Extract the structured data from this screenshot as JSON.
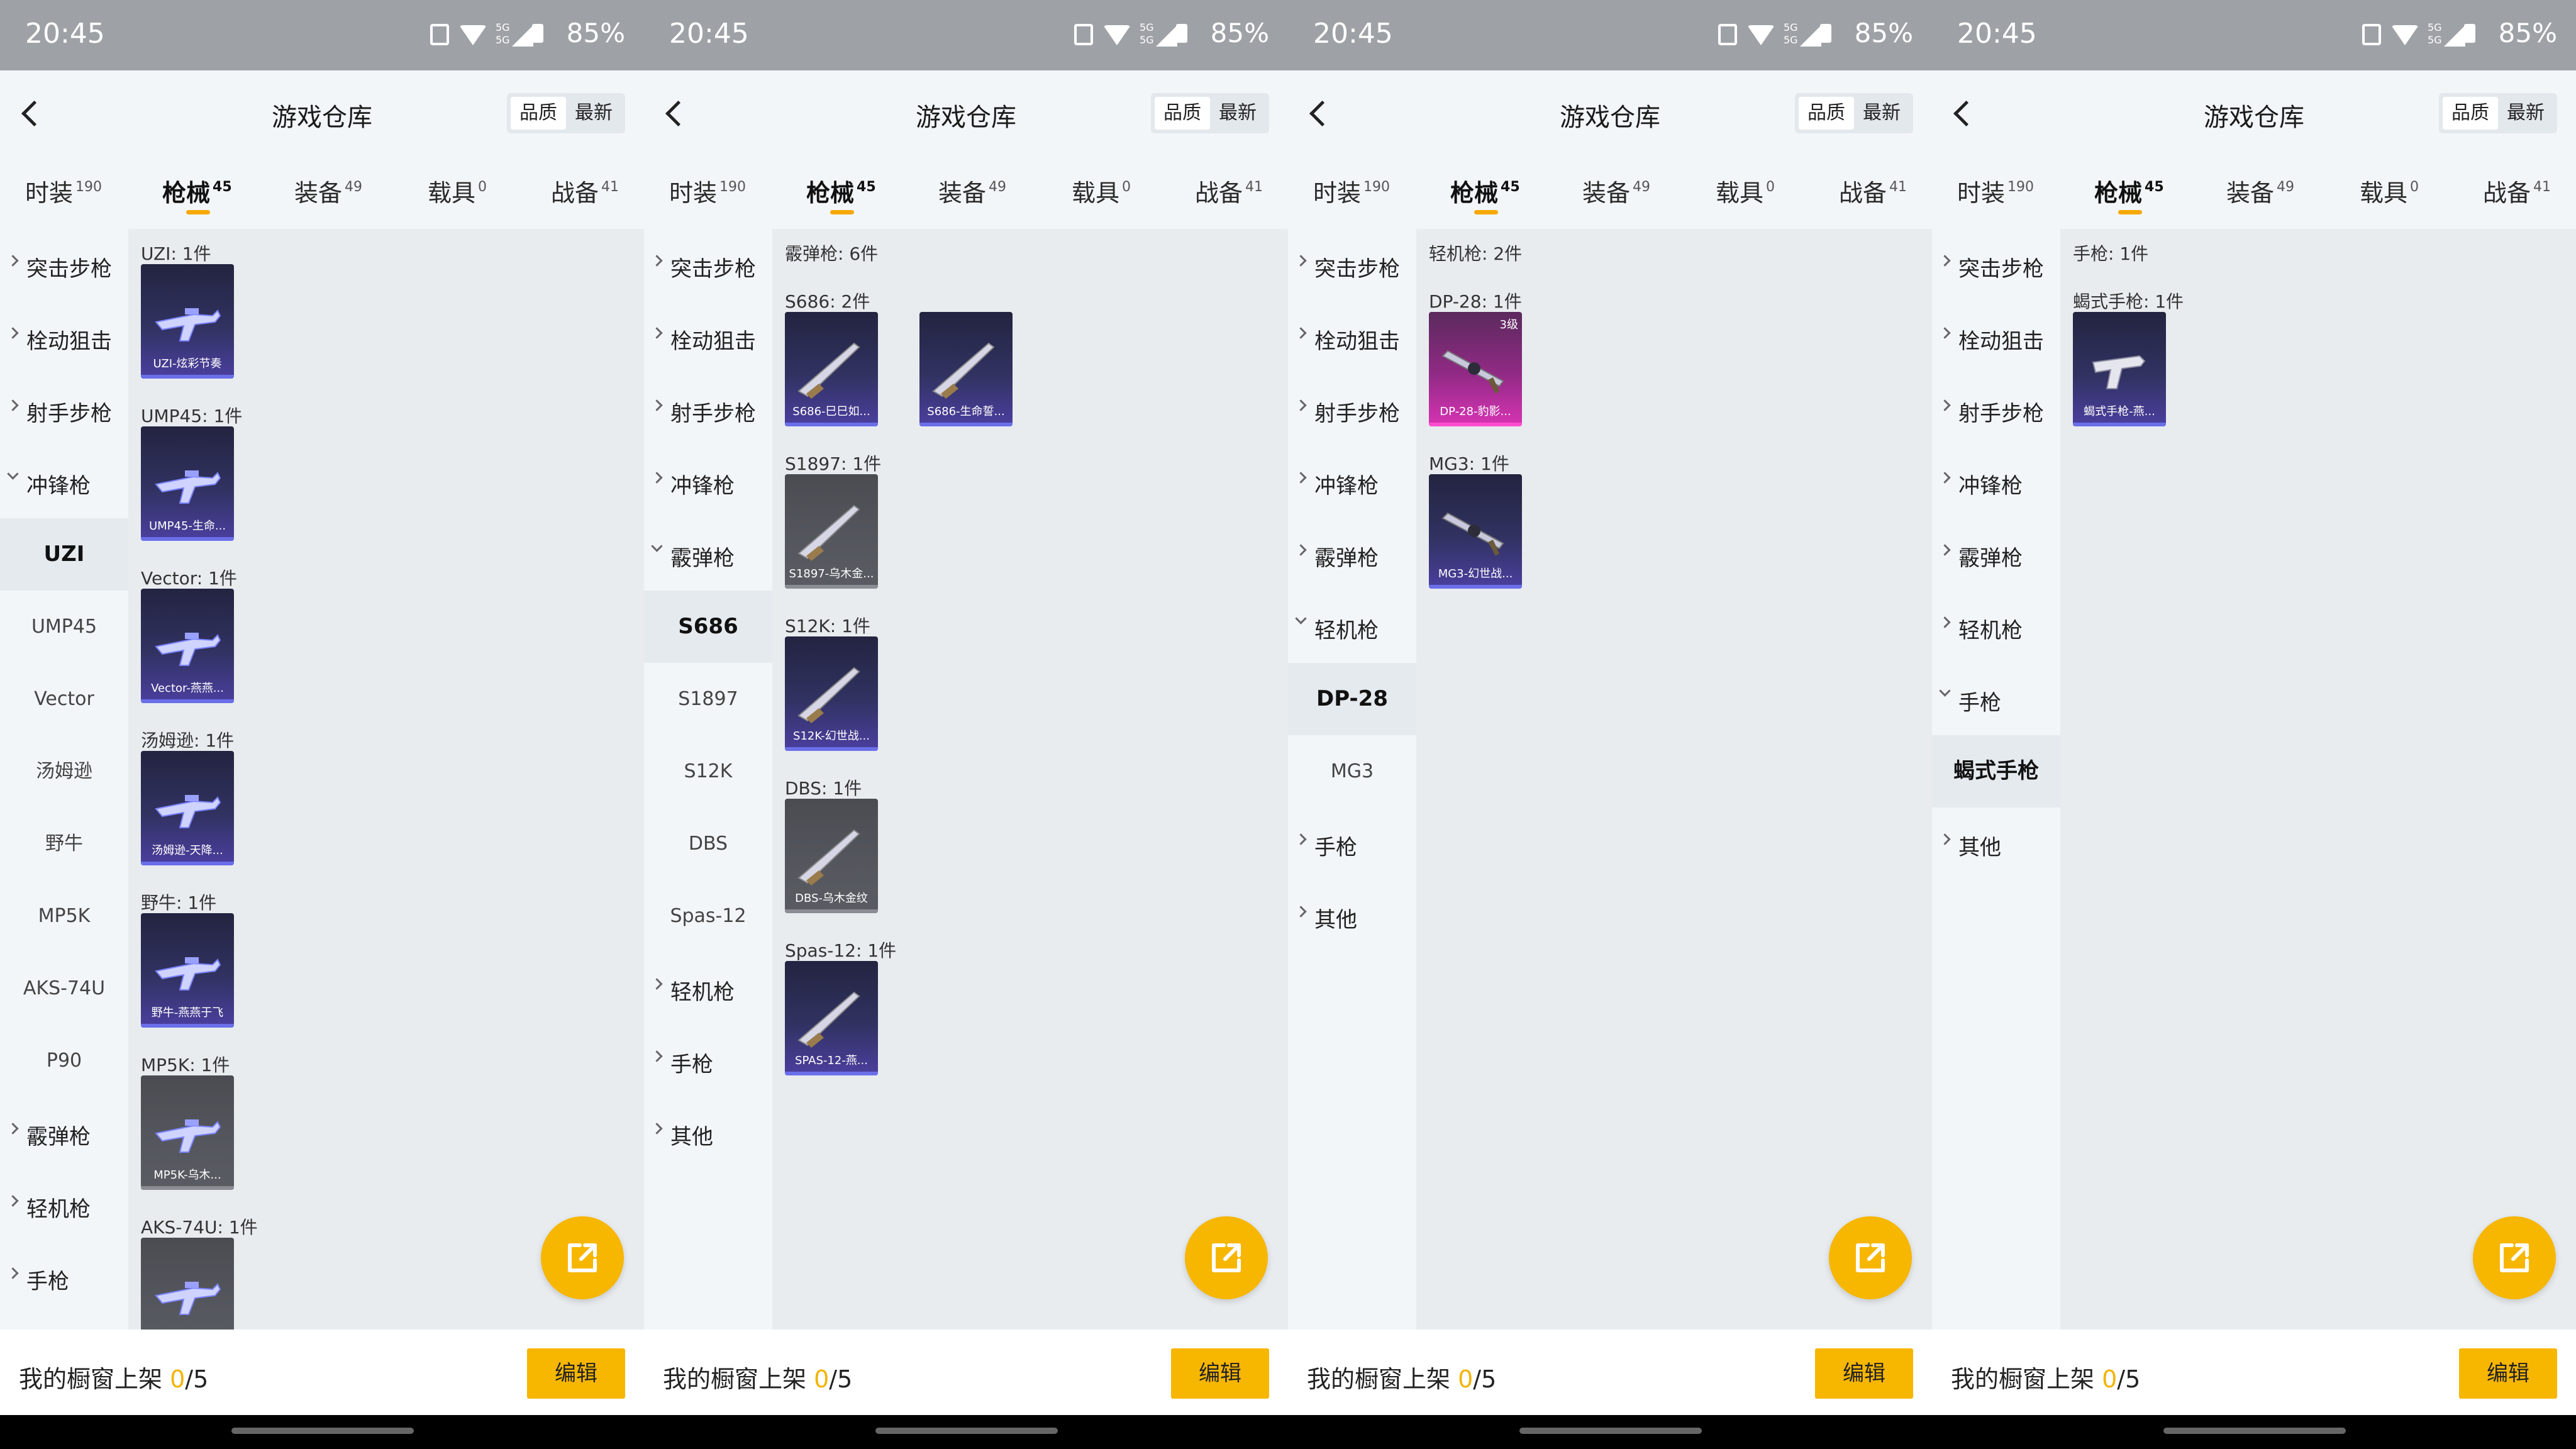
{
  "status_bar": {
    "time": "20:45",
    "battery": "85%"
  },
  "colors": {
    "accent": "#f7b600",
    "tier_purple": "#4b3fa0",
    "tier_pink": "#d834b4",
    "tier_grey": "#5a5c63"
  },
  "screens": [
    {
      "title": "游戏仓库",
      "sort": [
        "品质",
        "最新"
      ],
      "tabs": [
        {
          "label": "时装",
          "count": "190"
        },
        {
          "label": "枪械",
          "count": "45",
          "active": true
        },
        {
          "label": "装备",
          "count": "49"
        },
        {
          "label": "载具",
          "count": "0"
        },
        {
          "label": "战备",
          "count": "41"
        }
      ],
      "nav": [
        {
          "label": "突击步枪",
          "kind": "cat"
        },
        {
          "label": "栓动狙击",
          "kind": "cat"
        },
        {
          "label": "射手步枪",
          "kind": "cat"
        },
        {
          "label": "冲锋枪",
          "kind": "cat",
          "open": true
        },
        {
          "label": "UZI",
          "kind": "sub",
          "selected": true
        },
        {
          "label": "UMP45",
          "kind": "sub"
        },
        {
          "label": "Vector",
          "kind": "sub"
        },
        {
          "label": "汤姆逊",
          "kind": "sub"
        },
        {
          "label": "野牛",
          "kind": "sub"
        },
        {
          "label": "MP5K",
          "kind": "sub"
        },
        {
          "label": "AKS-74U",
          "kind": "sub"
        },
        {
          "label": "P90",
          "kind": "sub"
        },
        {
          "label": "霰弹枪",
          "kind": "cat"
        },
        {
          "label": "轻机枪",
          "kind": "cat"
        },
        {
          "label": "手枪",
          "kind": "cat"
        }
      ],
      "header_group": null,
      "groups": [
        {
          "title": "UZI: 1件",
          "items": [
            {
              "name": "UZI-炫彩节奏",
              "tier": "purple",
              "icon": "smg-icon"
            }
          ]
        },
        {
          "title": "UMP45: 1件",
          "items": [
            {
              "name": "UMP45-生命...",
              "tier": "purple",
              "icon": "smg-icon"
            }
          ]
        },
        {
          "title": "Vector: 1件",
          "items": [
            {
              "name": "Vector-燕燕...",
              "tier": "purple",
              "icon": "smg-icon"
            }
          ]
        },
        {
          "title": "汤姆逊: 1件",
          "items": [
            {
              "name": "汤姆逊-天降...",
              "tier": "purple",
              "icon": "smg-icon"
            }
          ]
        },
        {
          "title": "野牛: 1件",
          "items": [
            {
              "name": "野牛-燕燕于飞",
              "tier": "purple",
              "icon": "smg-icon"
            }
          ]
        },
        {
          "title": "MP5K: 1件",
          "items": [
            {
              "name": "MP5K-乌木...",
              "tier": "grey",
              "icon": "smg-icon"
            }
          ]
        },
        {
          "title": "AKS-74U: 1件",
          "items": [
            {
              "name": "",
              "tier": "grey",
              "icon": "smg-icon"
            }
          ]
        }
      ]
    },
    {
      "title": "游戏仓库",
      "sort": [
        "品质",
        "最新"
      ],
      "tabs": [
        {
          "label": "时装",
          "count": "190"
        },
        {
          "label": "枪械",
          "count": "45",
          "active": true
        },
        {
          "label": "装备",
          "count": "49"
        },
        {
          "label": "载具",
          "count": "0"
        },
        {
          "label": "战备",
          "count": "41"
        }
      ],
      "nav": [
        {
          "label": "突击步枪",
          "kind": "cat"
        },
        {
          "label": "栓动狙击",
          "kind": "cat"
        },
        {
          "label": "射手步枪",
          "kind": "cat"
        },
        {
          "label": "冲锋枪",
          "kind": "cat"
        },
        {
          "label": "霰弹枪",
          "kind": "cat",
          "open": true
        },
        {
          "label": "S686",
          "kind": "sub",
          "selected": true
        },
        {
          "label": "S1897",
          "kind": "sub"
        },
        {
          "label": "S12K",
          "kind": "sub"
        },
        {
          "label": "DBS",
          "kind": "sub"
        },
        {
          "label": "Spas-12",
          "kind": "sub"
        },
        {
          "label": "轻机枪",
          "kind": "cat"
        },
        {
          "label": "手枪",
          "kind": "cat"
        },
        {
          "label": "其他",
          "kind": "cat"
        }
      ],
      "header_group": "霰弹枪: 6件",
      "groups": [
        {
          "title": "S686: 2件",
          "items": [
            {
              "name": "S686-巳巳如...",
              "tier": "purple",
              "icon": "shotgun-icon"
            },
            {
              "name": "S686-生命誓...",
              "tier": "purple",
              "icon": "shotgun-icon"
            }
          ]
        },
        {
          "title": "S1897: 1件",
          "items": [
            {
              "name": "S1897-乌木金...",
              "tier": "grey",
              "icon": "shotgun-icon"
            }
          ]
        },
        {
          "title": "S12K: 1件",
          "items": [
            {
              "name": "S12K-幻世战...",
              "tier": "purple",
              "icon": "shotgun-icon"
            }
          ]
        },
        {
          "title": "DBS: 1件",
          "items": [
            {
              "name": "DBS-乌木金纹",
              "tier": "grey",
              "icon": "shotgun-icon"
            }
          ]
        },
        {
          "title": "Spas-12: 1件",
          "items": [
            {
              "name": "SPAS-12-燕...",
              "tier": "purple",
              "icon": "shotgun-icon"
            }
          ]
        }
      ]
    },
    {
      "title": "游戏仓库",
      "sort": [
        "品质",
        "最新"
      ],
      "tabs": [
        {
          "label": "时装",
          "count": "190"
        },
        {
          "label": "枪械",
          "count": "45",
          "active": true
        },
        {
          "label": "装备",
          "count": "49"
        },
        {
          "label": "载具",
          "count": "0"
        },
        {
          "label": "战备",
          "count": "41"
        }
      ],
      "nav": [
        {
          "label": "突击步枪",
          "kind": "cat"
        },
        {
          "label": "栓动狙击",
          "kind": "cat"
        },
        {
          "label": "射手步枪",
          "kind": "cat"
        },
        {
          "label": "冲锋枪",
          "kind": "cat"
        },
        {
          "label": "霰弹枪",
          "kind": "cat"
        },
        {
          "label": "轻机枪",
          "kind": "cat",
          "open": true
        },
        {
          "label": "DP-28",
          "kind": "sub",
          "selected": true
        },
        {
          "label": "MG3",
          "kind": "sub"
        },
        {
          "label": "手枪",
          "kind": "cat"
        },
        {
          "label": "其他",
          "kind": "cat"
        }
      ],
      "header_group": "轻机枪: 2件",
      "groups": [
        {
          "title": "DP-28: 1件",
          "items": [
            {
              "name": "DP-28-豹影...",
              "tier": "pink",
              "tier_label": "3级",
              "icon": "lmg-icon"
            }
          ]
        },
        {
          "title": "MG3: 1件",
          "items": [
            {
              "name": "MG3-幻世战...",
              "tier": "purple",
              "icon": "lmg-icon"
            }
          ]
        }
      ]
    },
    {
      "title": "游戏仓库",
      "sort": [
        "品质",
        "最新"
      ],
      "tabs": [
        {
          "label": "时装",
          "count": "190"
        },
        {
          "label": "枪械",
          "count": "45",
          "active": true
        },
        {
          "label": "装备",
          "count": "49"
        },
        {
          "label": "载具",
          "count": "0"
        },
        {
          "label": "战备",
          "count": "41"
        }
      ],
      "nav": [
        {
          "label": "突击步枪",
          "kind": "cat"
        },
        {
          "label": "栓动狙击",
          "kind": "cat"
        },
        {
          "label": "射手步枪",
          "kind": "cat"
        },
        {
          "label": "冲锋枪",
          "kind": "cat"
        },
        {
          "label": "霰弹枪",
          "kind": "cat"
        },
        {
          "label": "轻机枪",
          "kind": "cat"
        },
        {
          "label": "手枪",
          "kind": "cat",
          "open": true
        },
        {
          "label": "蝎式手枪",
          "kind": "sub",
          "selected": true
        },
        {
          "label": "其他",
          "kind": "cat"
        }
      ],
      "header_group": "手枪: 1件",
      "groups": [
        {
          "title": "蝎式手枪: 1件",
          "items": [
            {
              "name": "蝎式手枪-燕...",
              "tier": "purple",
              "icon": "pistol-icon"
            }
          ]
        }
      ]
    }
  ],
  "bottom_bar": {
    "label": "我的橱窗上架",
    "count": "0",
    "total": "/5",
    "edit_label": "编辑"
  }
}
